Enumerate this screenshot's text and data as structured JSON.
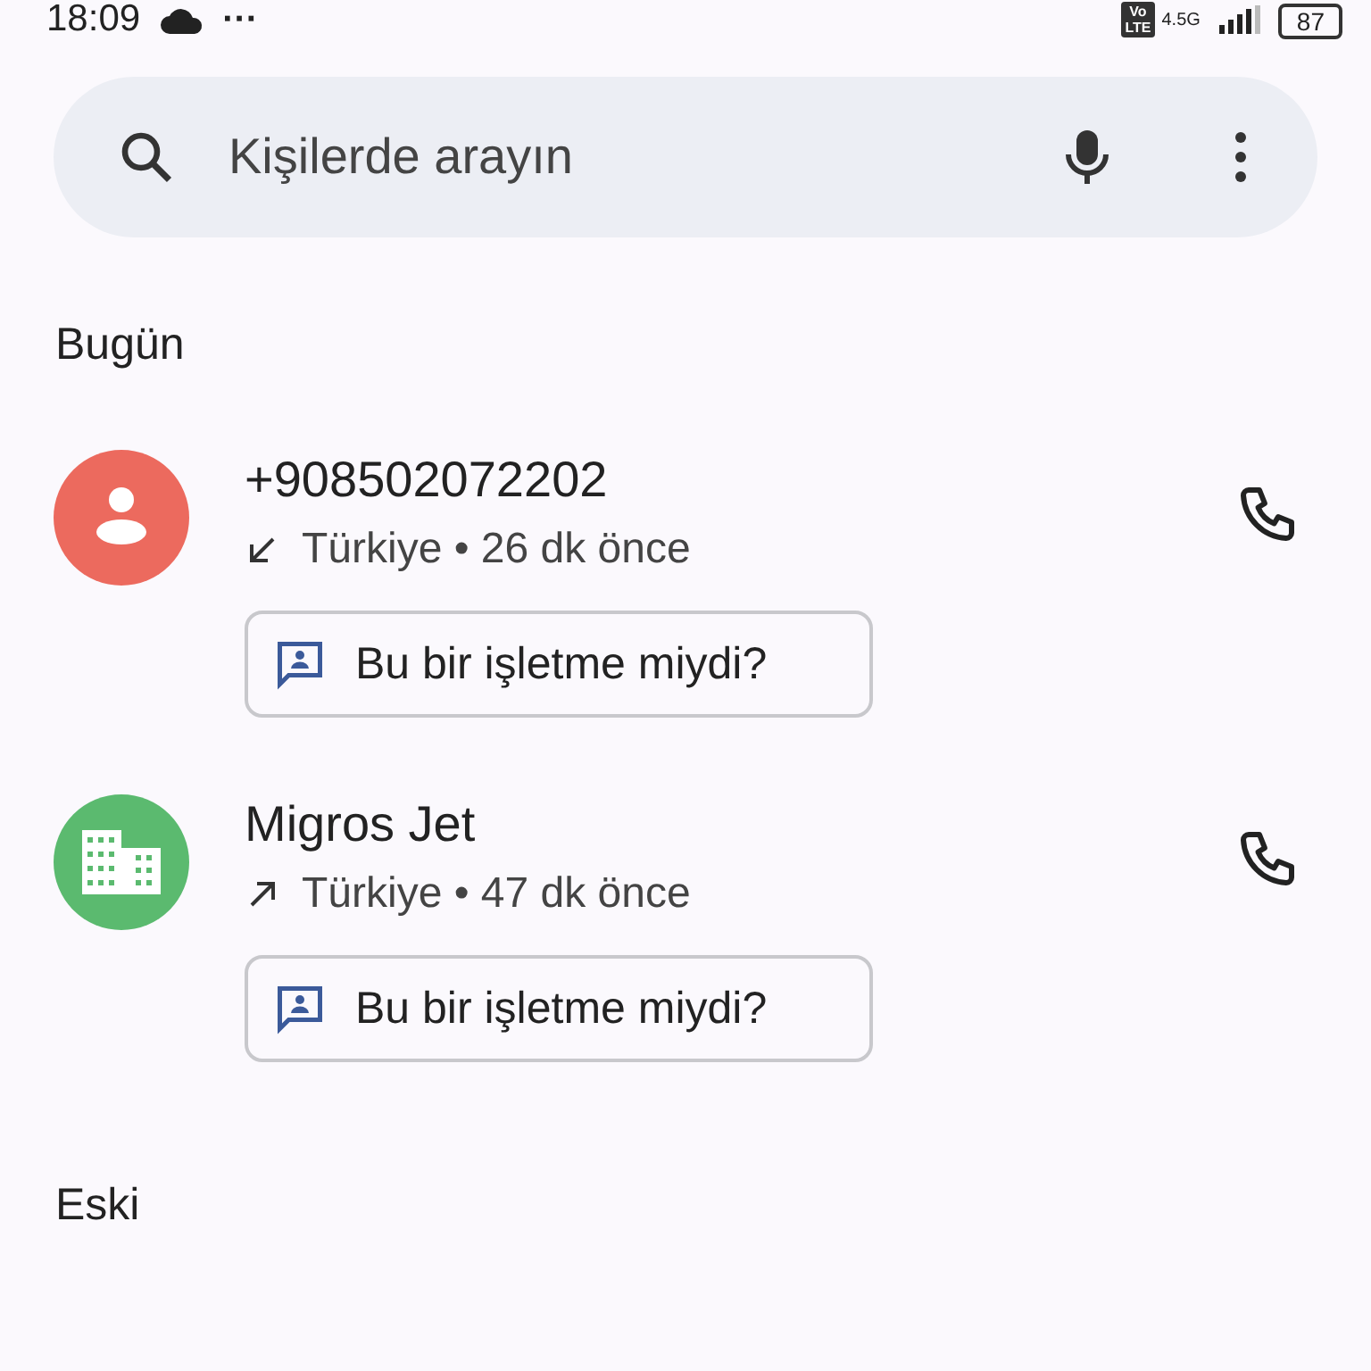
{
  "status_bar": {
    "time": "18:09",
    "more": "···",
    "volte": [
      "Vo",
      "LTE"
    ],
    "network": "4.5G",
    "battery": "87"
  },
  "search": {
    "placeholder": "Kişilerde arayın"
  },
  "sections": [
    {
      "title": "Bugün",
      "calls": [
        {
          "name": "+908502072202",
          "kind": "person",
          "color": "#ec6a5e",
          "incoming": true,
          "details": "Türkiye • 26 dk önce",
          "chip": "Bu bir işletme miydi?"
        },
        {
          "name": "Migros Jet",
          "kind": "business",
          "color": "#5bba6f",
          "incoming": false,
          "details": "Türkiye • 47 dk önce",
          "chip": "Bu bir işletme miydi?"
        }
      ]
    },
    {
      "title": "Eski"
    }
  ]
}
